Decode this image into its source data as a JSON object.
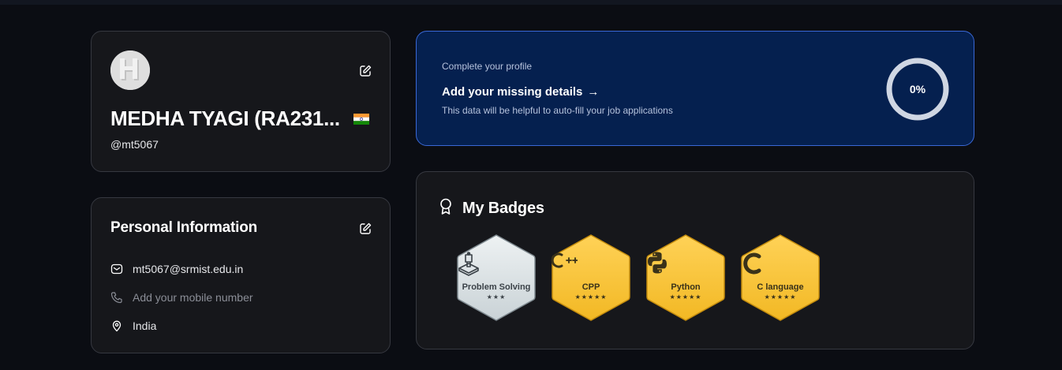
{
  "profile": {
    "name": "MEDHA TYAGI (RA231...",
    "handle": "@mt5067",
    "avatar_letter": "H"
  },
  "personal_info": {
    "title": "Personal Information",
    "email": "mt5067@srmist.edu.in",
    "mobile_placeholder": "Add your mobile number",
    "location": "India"
  },
  "complete_profile": {
    "label": "Complete your profile",
    "title": "Add your missing details",
    "arrow": "→",
    "description": "This data will be helpful to auto-fill your job applications",
    "progress_text": "0%",
    "progress_value": 0
  },
  "badges": {
    "title": "My Badges",
    "items": [
      {
        "name": "Problem Solving",
        "stars": "★★★",
        "tier": "silver",
        "icon": "problem-solving-icon"
      },
      {
        "name": "CPP",
        "stars": "★★★★★",
        "tier": "gold",
        "icon": "cpp-icon"
      },
      {
        "name": "Python",
        "stars": "★★★★★",
        "tier": "gold",
        "icon": "python-icon"
      },
      {
        "name": "C language",
        "stars": "★★★★★",
        "tier": "gold",
        "icon": "c-language-icon"
      }
    ]
  },
  "colors": {
    "background": "#0b0d13",
    "card": "#16171b",
    "accent_blue": "#05204f",
    "gold": "#f5c43a",
    "silver": "#d9e0e3"
  }
}
